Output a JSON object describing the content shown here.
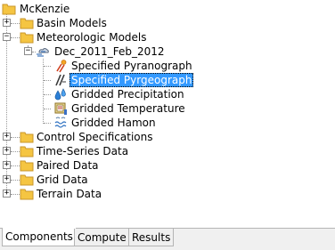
{
  "tree": {
    "root": {
      "label": "McKenzie",
      "icon": "folder-icon"
    },
    "nodes": [
      {
        "label": "Basin Models",
        "expander": "+",
        "icon": "folder-icon"
      },
      {
        "label": "Meteorologic Models",
        "expander": "−",
        "icon": "folder-icon"
      },
      {
        "label": "Dec_2011_Feb_2012",
        "expander": "−",
        "icon": "meteorologic-model-icon"
      },
      {
        "label": "Specified Pyranograph",
        "icon": "pyranograph-icon"
      },
      {
        "label": "Specified Pyrgeograph",
        "icon": "pyrgeograph-icon",
        "selected": true
      },
      {
        "label": "Gridded Precipitation",
        "icon": "precipitation-icon"
      },
      {
        "label": "Gridded Temperature",
        "icon": "temperature-icon"
      },
      {
        "label": "Gridded Hamon",
        "icon": "hamon-icon"
      },
      {
        "label": "Control Specifications",
        "expander": "+",
        "icon": "folder-icon"
      },
      {
        "label": "Time-Series Data",
        "expander": "+",
        "icon": "folder-icon"
      },
      {
        "label": "Paired Data",
        "expander": "+",
        "icon": "folder-icon"
      },
      {
        "label": "Grid Data",
        "expander": "+",
        "icon": "folder-icon"
      },
      {
        "label": "Terrain Data",
        "expander": "+",
        "icon": "folder-icon"
      }
    ]
  },
  "tabs": [
    {
      "label": "Components",
      "active": true
    },
    {
      "label": "Compute",
      "active": false
    },
    {
      "label": "Results",
      "active": false
    }
  ],
  "colors": {
    "folder": "#f5c542",
    "selection": "#3399ff"
  }
}
